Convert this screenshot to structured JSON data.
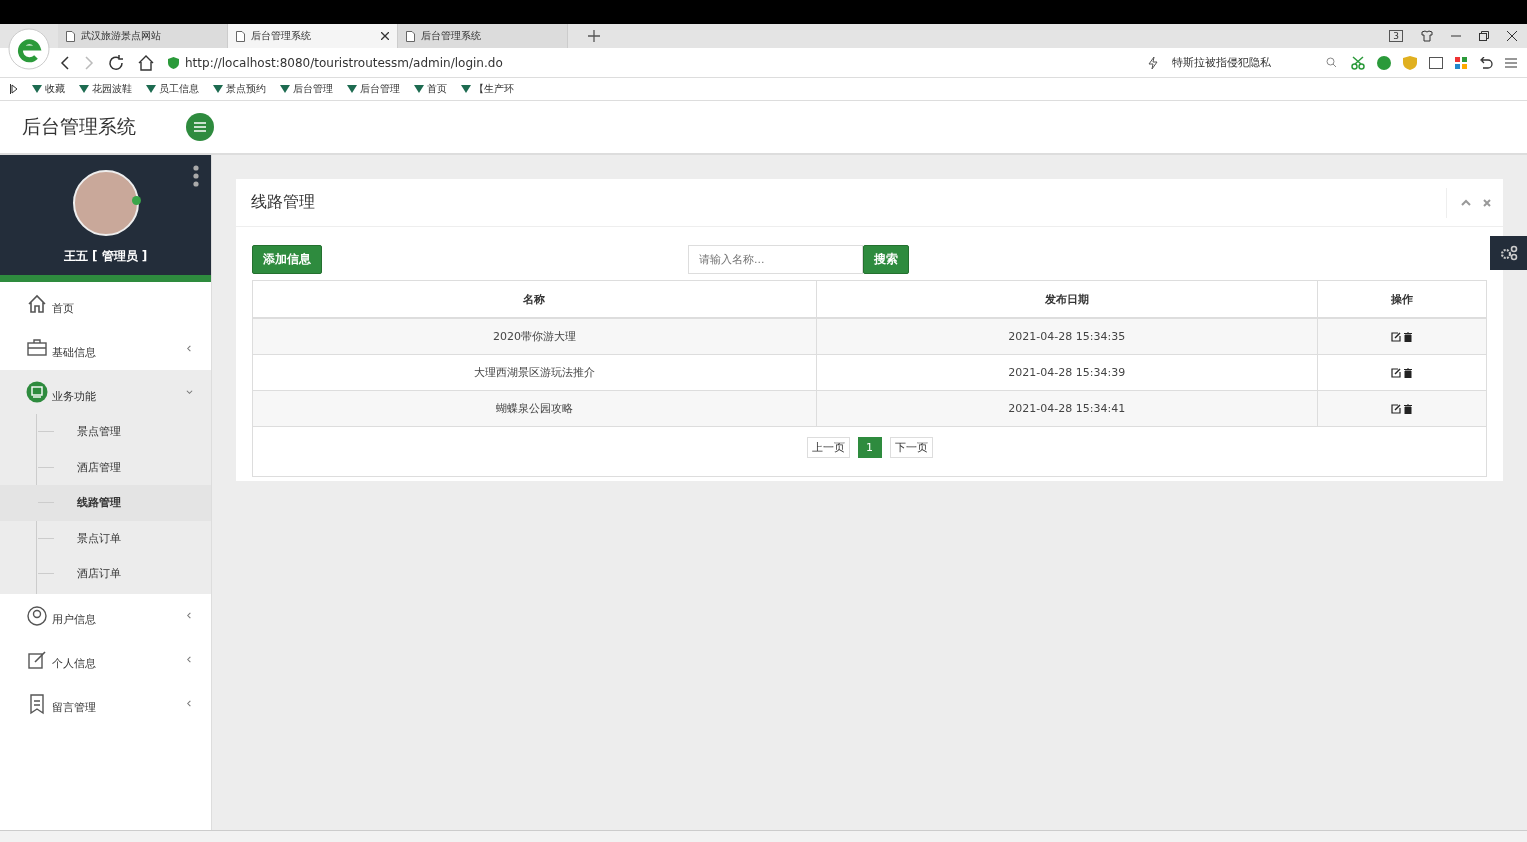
{
  "browser": {
    "tabs": [
      {
        "title": "武汉旅游景点网站",
        "selected": false
      },
      {
        "title": "后台管理系统",
        "selected": true
      },
      {
        "title": "后台管理系统",
        "selected": false
      }
    ],
    "tab_count": "3",
    "address": "http://localhost:8080/touristroutessm/admin/login.do",
    "search_text": "特斯拉被指侵犯隐私",
    "bookmarks": [
      "收藏",
      "花园波鞋",
      "员工信息",
      "景点预约",
      "后台管理",
      "后台管理",
      "首页",
      "【生产环"
    ]
  },
  "header": {
    "brand": "后台管理系统"
  },
  "profile": {
    "user": "王五 [ 管理员 ]"
  },
  "nav": [
    {
      "label": "首页"
    },
    {
      "label": "基础信息",
      "expanded": false
    },
    {
      "label": "业务功能",
      "expanded": true,
      "children": [
        {
          "label": "景点管理",
          "selected": false
        },
        {
          "label": "酒店管理",
          "selected": false
        },
        {
          "label": "线路管理",
          "selected": true
        },
        {
          "label": "景点订单",
          "selected": false
        },
        {
          "label": "酒店订单",
          "selected": false
        }
      ]
    },
    {
      "label": "用户信息",
      "expanded": false
    },
    {
      "label": "个人信息",
      "expanded": false
    },
    {
      "label": "留言管理",
      "expanded": false
    }
  ],
  "panel": {
    "title": "线路管理",
    "add_button": "添加信息",
    "search": {
      "placeholder": "请输入名称..."
    },
    "search_button": "搜索",
    "table": {
      "columns": [
        "名称",
        "发布日期",
        "操作"
      ],
      "rows": [
        {
          "name": "2020带你游大理",
          "date": "2021-04-28 15:34:35"
        },
        {
          "name": "大理西湖景区游玩法推介",
          "date": "2021-04-28 15:34:39"
        },
        {
          "name": "蝴蝶泉公园攻略",
          "date": "2021-04-28 15:34:41"
        }
      ]
    },
    "pagination": {
      "prev": "上一页",
      "pages": [
        {
          "label": "1",
          "selected": true
        }
      ],
      "next": "下一页"
    }
  }
}
